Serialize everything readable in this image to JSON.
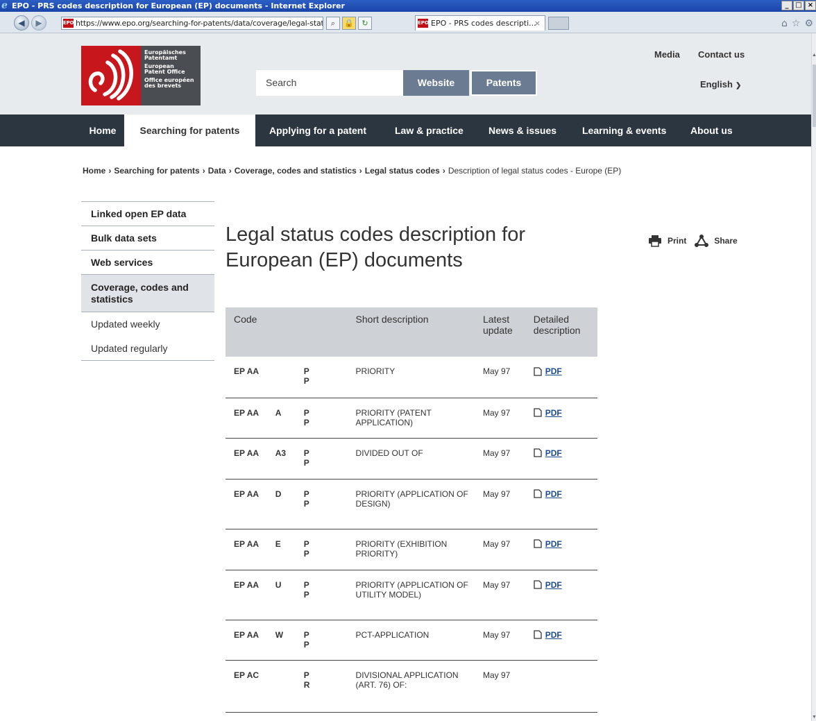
{
  "window": {
    "title": "EPO - PRS codes description for European (EP) documents - Internet Explorer",
    "buttons": [
      "_",
      "□",
      "×"
    ]
  },
  "browser": {
    "url": "https://www.epo.org/searching-for-patents/data/coverage/legal-status/prs-ep.l",
    "tab_title": "EPO - PRS codes descripti...",
    "favicon_text": "EPO"
  },
  "header": {
    "logo_lines": [
      "Europäisches",
      "Patentamt",
      "European",
      "Patent Office",
      "Office européen",
      "des brevets"
    ],
    "search_placeholder": "Search",
    "website_button": "Website",
    "patents_button": "Patents",
    "media_link": "Media",
    "contact_link": "Contact us",
    "language": "English"
  },
  "nav": {
    "items": [
      "Home",
      "Searching for patents",
      "Applying for a patent",
      "Law & practice",
      "News & issues",
      "Learning & events",
      "About us"
    ],
    "active_index": 1
  },
  "breadcrumb": [
    "Home",
    "Searching for patents",
    "Data",
    "Coverage, codes and statistics",
    "Legal status codes",
    "Description of legal status codes - Europe (EP)"
  ],
  "sidebar": {
    "items": [
      {
        "label": "Linked open EP data"
      },
      {
        "label": "Bulk data sets"
      },
      {
        "label": "Web services"
      },
      {
        "label": "Coverage, codes and statistics"
      },
      {
        "label": "Updated weekly"
      },
      {
        "label": "Updated regularly"
      }
    ]
  },
  "main": {
    "title": "Legal status codes description for European (EP) documents",
    "print_label": "Print",
    "share_label": "Share",
    "table": {
      "headers": [
        "Code",
        "Short description",
        "Latest update",
        "Detailed description"
      ],
      "rows": [
        {
          "country": "EP",
          "code": "AA",
          "kind": "",
          "type": "P P",
          "desc": "PRIORITY",
          "update": "May 97",
          "pdf": "PDF"
        },
        {
          "country": "EP",
          "code": "AA",
          "kind": "A",
          "type": "P P",
          "desc": "PRIORITY (PATENT APPLICATION)",
          "update": "May 97",
          "pdf": "PDF"
        },
        {
          "country": "EP",
          "code": "AA",
          "kind": "A3",
          "type": "P P",
          "desc": "DIVIDED OUT OF",
          "update": "May 97",
          "pdf": "PDF"
        },
        {
          "country": "EP",
          "code": "AA",
          "kind": "D",
          "type": "P P",
          "desc": "PRIORITY (APPLICATION OF DESIGN)",
          "update": "May 97",
          "pdf": "PDF"
        },
        {
          "country": "EP",
          "code": "AA",
          "kind": "E",
          "type": "P P",
          "desc": "PRIORITY (EXHIBITION PRIORITY)",
          "update": "May 97",
          "pdf": "PDF"
        },
        {
          "country": "EP",
          "code": "AA",
          "kind": "U",
          "type": "P P",
          "desc": "PRIORITY (APPLICATION OF UTILITY MODEL)",
          "update": "May 97",
          "pdf": "PDF"
        },
        {
          "country": "EP",
          "code": "AA",
          "kind": "W",
          "type": "P P",
          "desc": "PCT-APPLICATION",
          "update": "May 97",
          "pdf": "PDF"
        },
        {
          "country": "EP",
          "code": "AC",
          "kind": "",
          "type": "P R",
          "desc": "DIVISIONAL APPLICATION (ART. 76) OF:",
          "update": "May 97",
          "pdf": ""
        }
      ]
    }
  },
  "colors": {
    "brand_red": "#c8161d",
    "nav_dark": "#2c3640",
    "search_button": "#6a7b92",
    "table_header": "#ced1d5"
  }
}
